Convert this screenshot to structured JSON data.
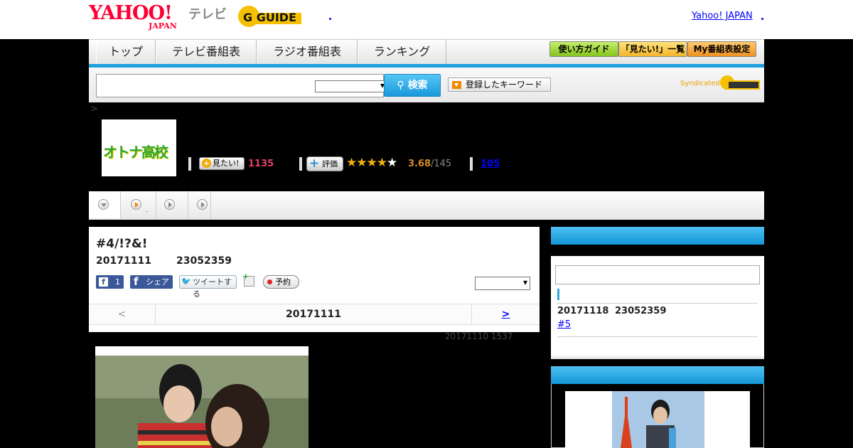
{
  "header": {
    "logo_main": "YAHOO!",
    "logo_sub": "JAPAN",
    "tv_label": "テレビ",
    "gguide_logo": "G GUIDE",
    "yahoo_japan_link": "Yahoo! JAPAN"
  },
  "nav": {
    "items": [
      {
        "label": "トップ"
      },
      {
        "label": "テレビ番組表"
      },
      {
        "label": "ラジオ番組表"
      },
      {
        "label": "ランキング"
      }
    ],
    "util": [
      {
        "label": "使い方ガイド",
        "color": "#9ad62e"
      },
      {
        "label": "「見たい!」一覧",
        "color": "#f7c33a"
      },
      {
        "label": "My番組表設定",
        "color": "#f3a535"
      }
    ],
    "accent_color": "#1ea0e0"
  },
  "search": {
    "button_label": "検索",
    "keyword_button": "登録したキーワード",
    "syndicated": "Syndicated"
  },
  "breadcrumb": ">",
  "program": {
    "thumb_title": "オトナ高校",
    "mitai_label": "見たい!",
    "mitai_count": "1135",
    "rate_label": "評価",
    "stars_filled": 4,
    "rating": "3.68",
    "rating_count": "/145",
    "review_count": "105"
  },
  "tabs": [
    {
      "icon": "chevron-down-icon"
    },
    {
      "icon": "play-icon",
      "dot": "."
    },
    {
      "icon": "play-icon"
    },
    {
      "icon": "play-icon"
    }
  ],
  "episode": {
    "title": "#4/!?&!",
    "date": "20171111",
    "time": "23052359",
    "fb_like_count": "1",
    "fb_share": "シェア",
    "tweet": "ツイートする",
    "record": "予約",
    "pager_prev": "<",
    "pager_date": "20171111",
    "pager_next": ">",
    "updated": "20171110  1537"
  },
  "sidebar": {
    "next_date": "20171118",
    "next_time": "23052359",
    "next_link": "#5"
  }
}
